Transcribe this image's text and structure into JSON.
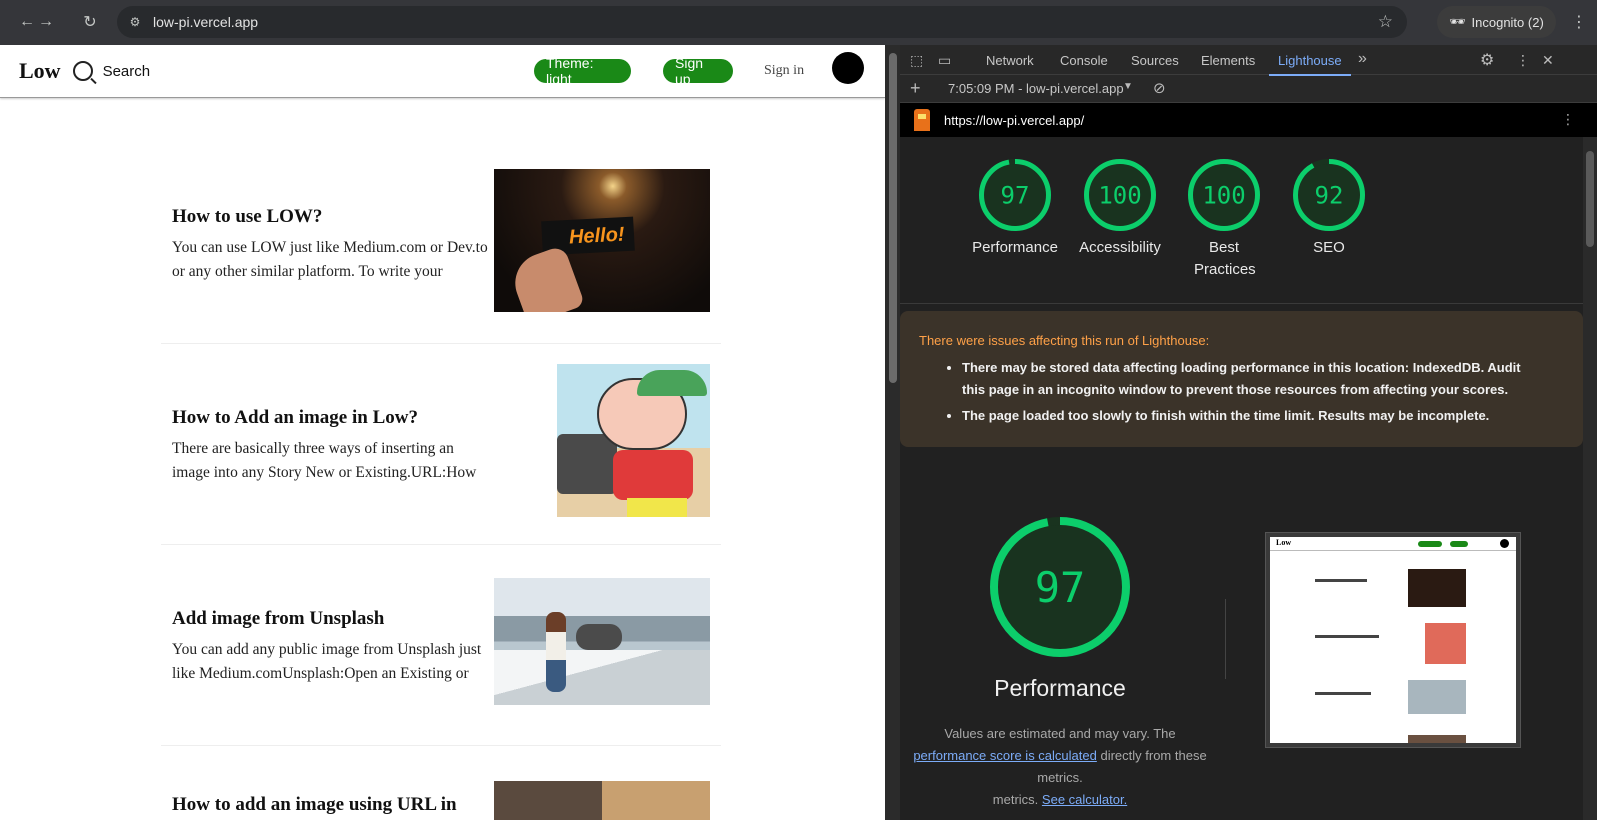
{
  "browser": {
    "url": "low-pi.vercel.app",
    "incognito_label": "Incognito (2)"
  },
  "site": {
    "logo": "Low",
    "search_label": "Search",
    "theme_button": "Theme: light",
    "signup_button": "Sign up",
    "signin_link": "Sign in",
    "articles": [
      {
        "title": "How to use LOW?",
        "excerpt": "You can use LOW just like Medium.com or Dev.to or any other similar platform. To write your",
        "thumb_text": "Hello!"
      },
      {
        "title": "How to Add an image in Low?",
        "excerpt": "There are basically three ways of inserting an image into any Story New or Existing.URL:How"
      },
      {
        "title": "Add image from Unsplash",
        "excerpt": "You can add any public image from Unsplash just like Medium.comUnsplash:Open an Existing or"
      },
      {
        "title": "How to add an image using URL in"
      }
    ]
  },
  "devtools": {
    "tabs": [
      "Network",
      "Console",
      "Sources",
      "Elements",
      "Lighthouse"
    ],
    "active_tab": "Lighthouse",
    "run_label": "7:05:09 PM - low-pi.vercel.app",
    "report_url": "https://low-pi.vercel.app/",
    "scores": [
      {
        "label": "Performance",
        "value": 97
      },
      {
        "label": "Accessibility",
        "value": 100
      },
      {
        "label": "Best Practices",
        "value": 100
      },
      {
        "label": "SEO",
        "value": 92
      }
    ],
    "warning": {
      "title": "There were issues affecting this run of Lighthouse:",
      "items": [
        "There may be stored data affecting loading performance in this location: IndexedDB. Audit this page in an incognito window to prevent those resources from affecting your scores.",
        "The page loaded too slowly to finish within the time limit. Results may be incomplete."
      ]
    },
    "performance": {
      "score": 97,
      "label": "Performance",
      "desc_1": "Values are estimated and may vary. The",
      "desc_link_1": "performance score is calculated",
      "desc_2": "directly from these metrics.",
      "desc_link_2": "See calculator."
    },
    "colors": {
      "pass": "#0cce6b",
      "pass_bg": "#19331f",
      "accent": "#7cacf8",
      "site_green": "#1a8917"
    }
  }
}
